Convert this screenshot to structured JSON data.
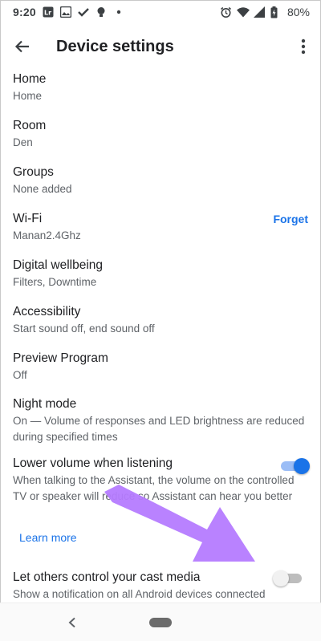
{
  "status_bar": {
    "time": "9:20",
    "battery": "80%",
    "icons_left": [
      "lr-icon",
      "photo-icon",
      "check-icon",
      "bulb-icon",
      "dot-icon"
    ],
    "icons_right": [
      "alarm-icon",
      "wifi-icon",
      "signal-icon",
      "battery-icon"
    ]
  },
  "app_bar": {
    "title": "Device settings"
  },
  "settings": [
    {
      "title": "Home",
      "subtitle": "Home"
    },
    {
      "title": "Room",
      "subtitle": "Den"
    },
    {
      "title": "Groups",
      "subtitle": "None added"
    },
    {
      "title": "Wi-Fi",
      "subtitle": "Manan2.4Ghz",
      "action": "Forget"
    },
    {
      "title": "Digital wellbeing",
      "subtitle": "Filters, Downtime"
    },
    {
      "title": "Accessibility",
      "subtitle": "Start sound off, end sound off"
    },
    {
      "title": "Preview Program",
      "subtitle": "Off"
    },
    {
      "title": "Night mode",
      "subtitle": "On — Volume of responses and LED brightness are reduced during specified times"
    },
    {
      "title": "Lower volume when listening",
      "subtitle": "When talking to the Assistant, the volume on the controlled TV or speaker will reduce so Assistant can hear you better",
      "toggle": true
    },
    {
      "title": "Let others control your cast media",
      "subtitle": "Show a notification on all Android devices connected",
      "toggle": false
    }
  ],
  "learn_more": "Learn more",
  "colors": {
    "accent": "#1a73e8",
    "annotation_arrow": "#b57bff"
  }
}
